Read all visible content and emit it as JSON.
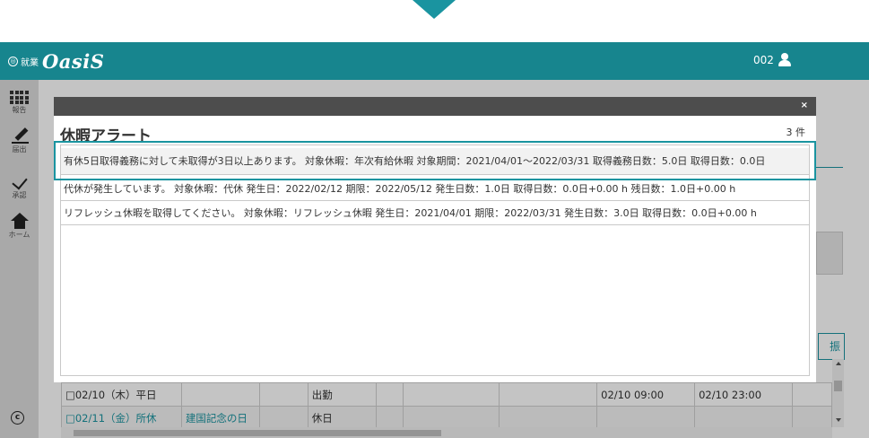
{
  "header": {
    "logo_sub": "就業",
    "logo_main": "OasiS",
    "logo_mark": "◎",
    "user_id": "002"
  },
  "nav": {
    "items": [
      {
        "label": "報告",
        "icon": "grid-icon"
      },
      {
        "label": "届出",
        "icon": "pencil-icon"
      },
      {
        "label": "承認",
        "icon": "check-icon"
      },
      {
        "label": "ホーム",
        "icon": "home-icon"
      }
    ],
    "copyright_symbol": "c"
  },
  "background": {
    "tab_label": "振",
    "rows": [
      {
        "date": "□02/10（木）平日",
        "holiday": "",
        "col3": "",
        "status": "出勤",
        "start": "02/10 09:00",
        "end": "02/10 23:00"
      },
      {
        "date": "□02/11（金）所休",
        "holiday": "建国記念の日",
        "col3": "",
        "status": "休日",
        "start": "",
        "end": ""
      }
    ]
  },
  "modal": {
    "close_label": "×",
    "title": "休暇アラート",
    "count": "3 件",
    "alerts": [
      "有休5日取得義務に対して未取得が3日以上あります。 対象休暇：年次有給休暇  対象期間：2021/04/01～2022/03/31    取得義務日数：5.0日    取得日数：0.0日",
      "代休が発生しています。 対象休暇：代休  発生日：2022/02/12  期限：2022/05/12    発生日数：1.0日    取得日数：0.0日+0.00 h    残日数：1.0日+0.00 h",
      "リフレッシュ休暇を取得してください。 対象休暇：リフレッシュ休暇  発生日：2021/04/01  期限：2022/03/31    発生日数：3.0日    取得日数：0.0日+0.00 h"
    ]
  },
  "colors": {
    "brand": "#17858e",
    "accent": "#1a94a0",
    "modal_titlebar": "#4d4d4d"
  }
}
